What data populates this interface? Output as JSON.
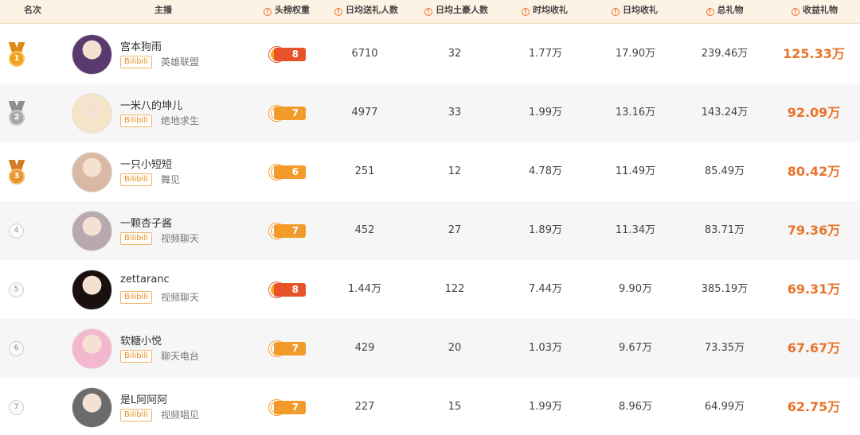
{
  "headers": {
    "rank": "名次",
    "anchor": "主播",
    "weight": "头榜权重",
    "daily_givers": "日均送礼人数",
    "daily_rich": "日均土豪人数",
    "hourly_income": "时均收礼",
    "daily_income": "日均收礼",
    "total_gifts": "总礼物",
    "revenue_gifts": "收益礼物"
  },
  "rows": [
    {
      "rank": "1",
      "medal": "gold",
      "name": "宫本狗雨",
      "platform": "Bilibili",
      "category": "英雄联盟",
      "weight_icon": "sun-icon",
      "weight": "8",
      "daily_givers": "6710",
      "daily_rich": "32",
      "hourly_income": "1.77万",
      "daily_income": "17.90万",
      "total_gifts": "239.46万",
      "revenue_gifts": "125.33万",
      "avatar_color": "#5a3a6e"
    },
    {
      "rank": "2",
      "medal": "silver",
      "name": "一米八的坤儿",
      "platform": "Bilibili",
      "category": "绝地求生",
      "weight_icon": "moon-icon",
      "weight": "7",
      "daily_givers": "4977",
      "daily_rich": "33",
      "hourly_income": "1.99万",
      "daily_income": "13.16万",
      "total_gifts": "143.24万",
      "revenue_gifts": "92.09万",
      "avatar_color": "#f4e4c8"
    },
    {
      "rank": "3",
      "medal": "bronze",
      "name": "一只小短短",
      "platform": "Bilibili",
      "category": "舞见",
      "weight_icon": "moon-icon",
      "weight": "6",
      "daily_givers": "251",
      "daily_rich": "12",
      "hourly_income": "4.78万",
      "daily_income": "11.49万",
      "total_gifts": "85.49万",
      "revenue_gifts": "80.42万",
      "avatar_color": "#d9b9a3"
    },
    {
      "rank": "4",
      "medal": "",
      "name": "一颗杏子酱",
      "platform": "Bilibili",
      "category": "视频聊天",
      "weight_icon": "moon-icon",
      "weight": "7",
      "daily_givers": "452",
      "daily_rich": "27",
      "hourly_income": "1.89万",
      "daily_income": "11.34万",
      "total_gifts": "83.71万",
      "revenue_gifts": "79.36万",
      "avatar_color": "#b8a9ae"
    },
    {
      "rank": "5",
      "medal": "",
      "name": "zettaranc",
      "platform": "Bilibili",
      "category": "视频聊天",
      "weight_icon": "sun-icon",
      "weight": "8",
      "daily_givers": "1.44万",
      "daily_rich": "122",
      "hourly_income": "7.44万",
      "daily_income": "9.90万",
      "total_gifts": "385.19万",
      "revenue_gifts": "69.31万",
      "avatar_color": "#1a1010"
    },
    {
      "rank": "6",
      "medal": "",
      "name": "软糖小悦",
      "platform": "Bilibili",
      "category": "聊天电台",
      "weight_icon": "moon-icon",
      "weight": "7",
      "daily_givers": "429",
      "daily_rich": "20",
      "hourly_income": "1.03万",
      "daily_income": "9.67万",
      "total_gifts": "73.35万",
      "revenue_gifts": "67.67万",
      "avatar_color": "#f3b8cf"
    },
    {
      "rank": "7",
      "medal": "",
      "name": "是L阿阿阿",
      "platform": "Bilibili",
      "category": "视频唱见",
      "weight_icon": "moon-icon",
      "weight": "7",
      "daily_givers": "227",
      "daily_rich": "15",
      "hourly_income": "1.99万",
      "daily_income": "8.96万",
      "total_gifts": "64.99万",
      "revenue_gifts": "62.75万",
      "avatar_color": "#6b6b6b"
    }
  ],
  "colors": {
    "accent": "#e8742c",
    "header_bg": "#fdf3e4",
    "alt_row_bg": "#f6f6f6",
    "platform_tag": "#e8901f"
  }
}
